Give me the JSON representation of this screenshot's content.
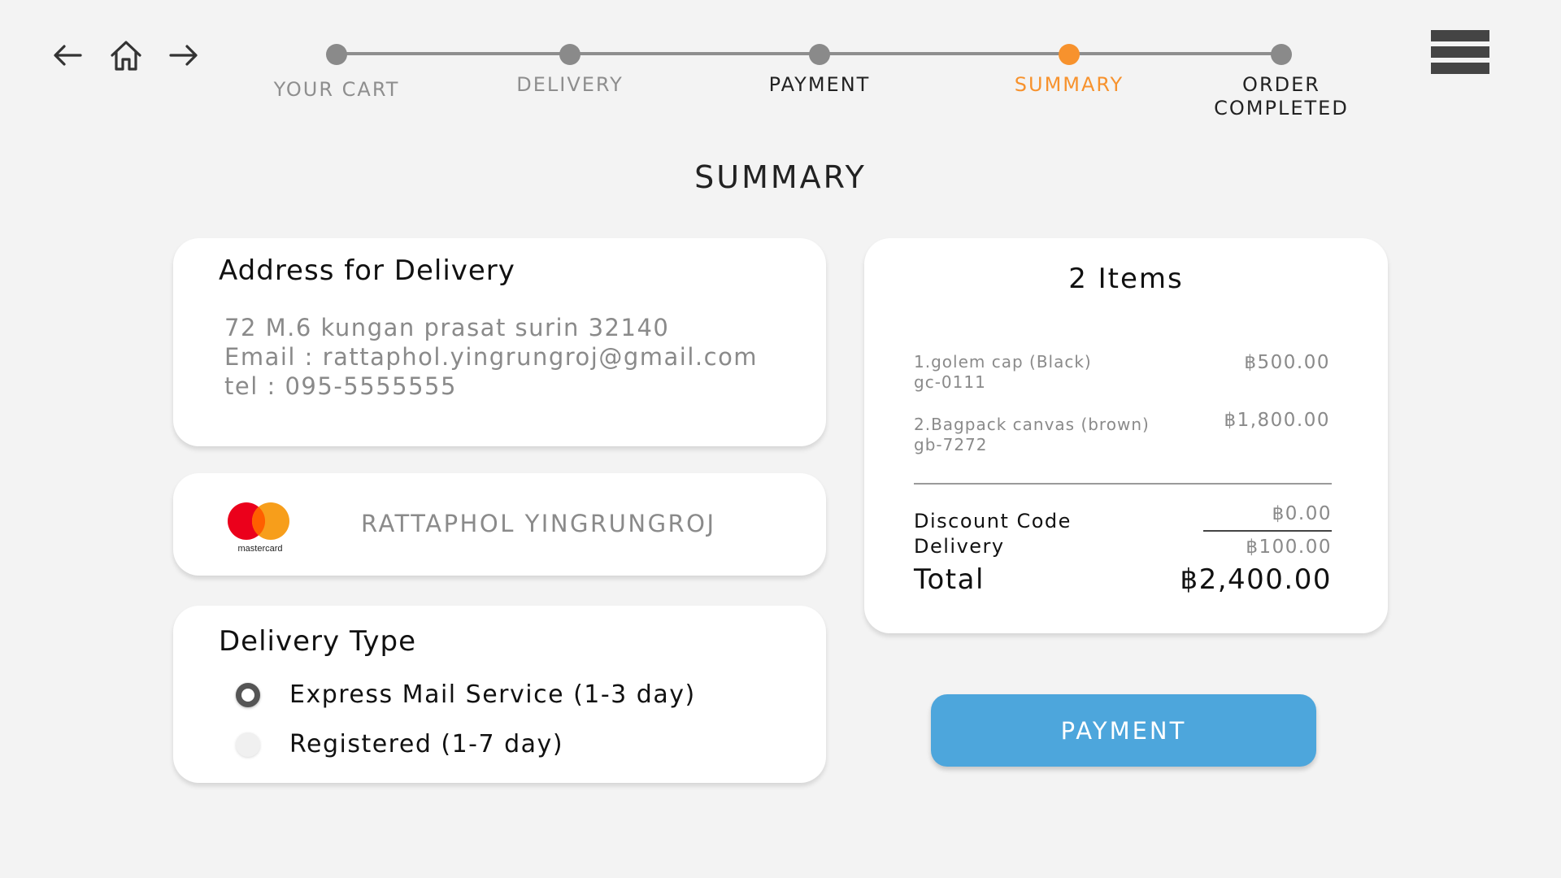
{
  "nav": {
    "back_icon": "arrow-left-icon",
    "home_icon": "home-icon",
    "forward_icon": "arrow-right-icon",
    "menu_icon": "hamburger-menu-icon"
  },
  "stepper": {
    "steps": [
      {
        "label": "YOUR CART",
        "state": "past"
      },
      {
        "label": "DELIVERY",
        "state": "past"
      },
      {
        "label": "PAYMENT",
        "state": "current"
      },
      {
        "label": "SUMMARY",
        "state": "active"
      },
      {
        "label": "ORDER\nCOMPLETED",
        "state": "upcoming"
      }
    ],
    "active_color": "#f7922d",
    "inactive_color": "#8a8a8a"
  },
  "page": {
    "title": "SUMMARY"
  },
  "address": {
    "heading": "Address for Delivery",
    "line1": "72 M.6 kungan prasat surin 32140",
    "line2": "Email : rattaphol.yingrungroj@gmail.com",
    "line3": "tel : 095-5555555"
  },
  "payment_card": {
    "brand_icon": "mastercard-logo-icon",
    "brand_text": "mastercard",
    "cardholder": "RATTAPHOL YINGRUNGROJ"
  },
  "delivery": {
    "heading": "Delivery Type",
    "options": [
      {
        "label": "Express Mail Service (1-3 day)",
        "selected": true
      },
      {
        "label": "Registered (1-7 day)",
        "selected": false
      }
    ]
  },
  "summary": {
    "title": "2 Items",
    "items": [
      {
        "name": "1.golem cap (Black)",
        "sku": "gc-0111",
        "price": "฿500.00"
      },
      {
        "name": "2.Bagpack canvas (brown)",
        "sku": "gb-7272",
        "price": "฿1,800.00"
      }
    ],
    "discount_label": "Discount Code",
    "discount_value": "฿0.00",
    "delivery_label": "Delivery",
    "delivery_value": "฿100.00",
    "total_label": "Total",
    "total_value": "฿2,400.00"
  },
  "actions": {
    "payment_label": "PAYMENT",
    "payment_color": "#4da6dc"
  }
}
